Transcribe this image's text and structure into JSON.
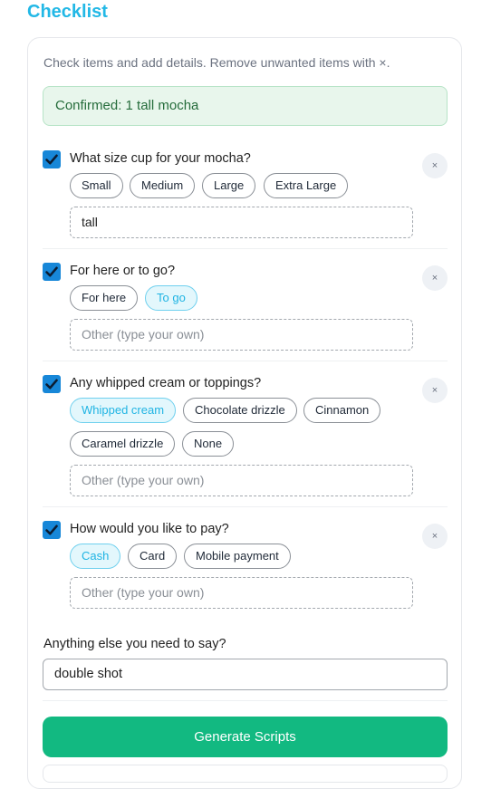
{
  "page": {
    "title": "Checklist"
  },
  "card": {
    "instructions": "Check items and add details. Remove unwanted items with ×.",
    "confirmation": "Confirmed: 1 tall mocha"
  },
  "questions": [
    {
      "label": "What size cup for your mocha?",
      "checked": true,
      "remove": "×",
      "options": [
        {
          "label": "Small",
          "selected": false
        },
        {
          "label": "Medium",
          "selected": false
        },
        {
          "label": "Large",
          "selected": false
        },
        {
          "label": "Extra Large",
          "selected": false
        }
      ],
      "other_value": "tall",
      "other_placeholder": "Other (type your own)"
    },
    {
      "label": "For here or to go?",
      "checked": true,
      "remove": "×",
      "options": [
        {
          "label": "For here",
          "selected": false
        },
        {
          "label": "To go",
          "selected": true
        }
      ],
      "other_value": "",
      "other_placeholder": "Other (type your own)"
    },
    {
      "label": "Any whipped cream or toppings?",
      "checked": true,
      "remove": "×",
      "options": [
        {
          "label": "Whipped cream",
          "selected": true
        },
        {
          "label": "Chocolate drizzle",
          "selected": false
        },
        {
          "label": "Cinnamon",
          "selected": false
        },
        {
          "label": "Caramel drizzle",
          "selected": false
        },
        {
          "label": "None",
          "selected": false
        }
      ],
      "other_value": "",
      "other_placeholder": "Other (type your own)"
    },
    {
      "label": "How would you like to pay?",
      "checked": true,
      "remove": "×",
      "options": [
        {
          "label": "Cash",
          "selected": true
        },
        {
          "label": "Card",
          "selected": false
        },
        {
          "label": "Mobile payment",
          "selected": false
        }
      ],
      "other_value": "",
      "other_placeholder": "Other (type your own)"
    }
  ],
  "extra": {
    "label": "Anything else you need to say?",
    "value": "double shot"
  },
  "generate_button": "Generate Scripts",
  "colors": {
    "accent": "#22b8e6",
    "checkbox": "#1787d8",
    "generate": "#12b981",
    "confirm_bg": "#e8f6ec",
    "confirm_text": "#256c3b"
  }
}
